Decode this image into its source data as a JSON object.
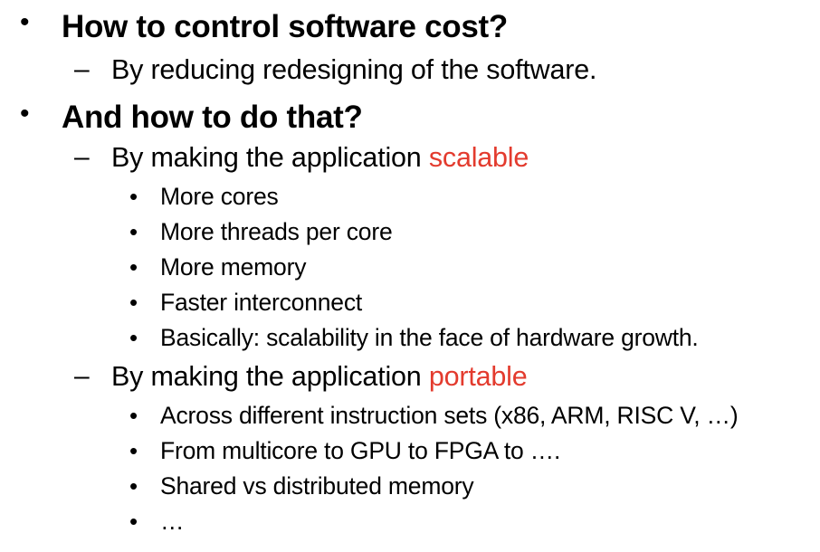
{
  "bullets": {
    "l1": "•",
    "l2": "–",
    "l3": "•"
  },
  "accent_color": "#e33b2e",
  "items": [
    {
      "text": "How to control software cost?",
      "children": [
        {
          "text": "By reducing redesigning of the software."
        }
      ]
    },
    {
      "text": "And how to do that?",
      "children": [
        {
          "text": "By making the application ",
          "highlight": "scalable",
          "children": [
            "More cores",
            "More threads per core",
            "More memory",
            "Faster interconnect",
            "Basically: scalability in the face of hardware growth."
          ]
        },
        {
          "text": "By making the application ",
          "highlight": "portable",
          "children": [
            "Across different instruction sets (x86, ARM, RISC V, …)",
            "From multicore to GPU to FPGA to ….",
            "Shared vs distributed memory",
            "…"
          ]
        }
      ]
    }
  ]
}
